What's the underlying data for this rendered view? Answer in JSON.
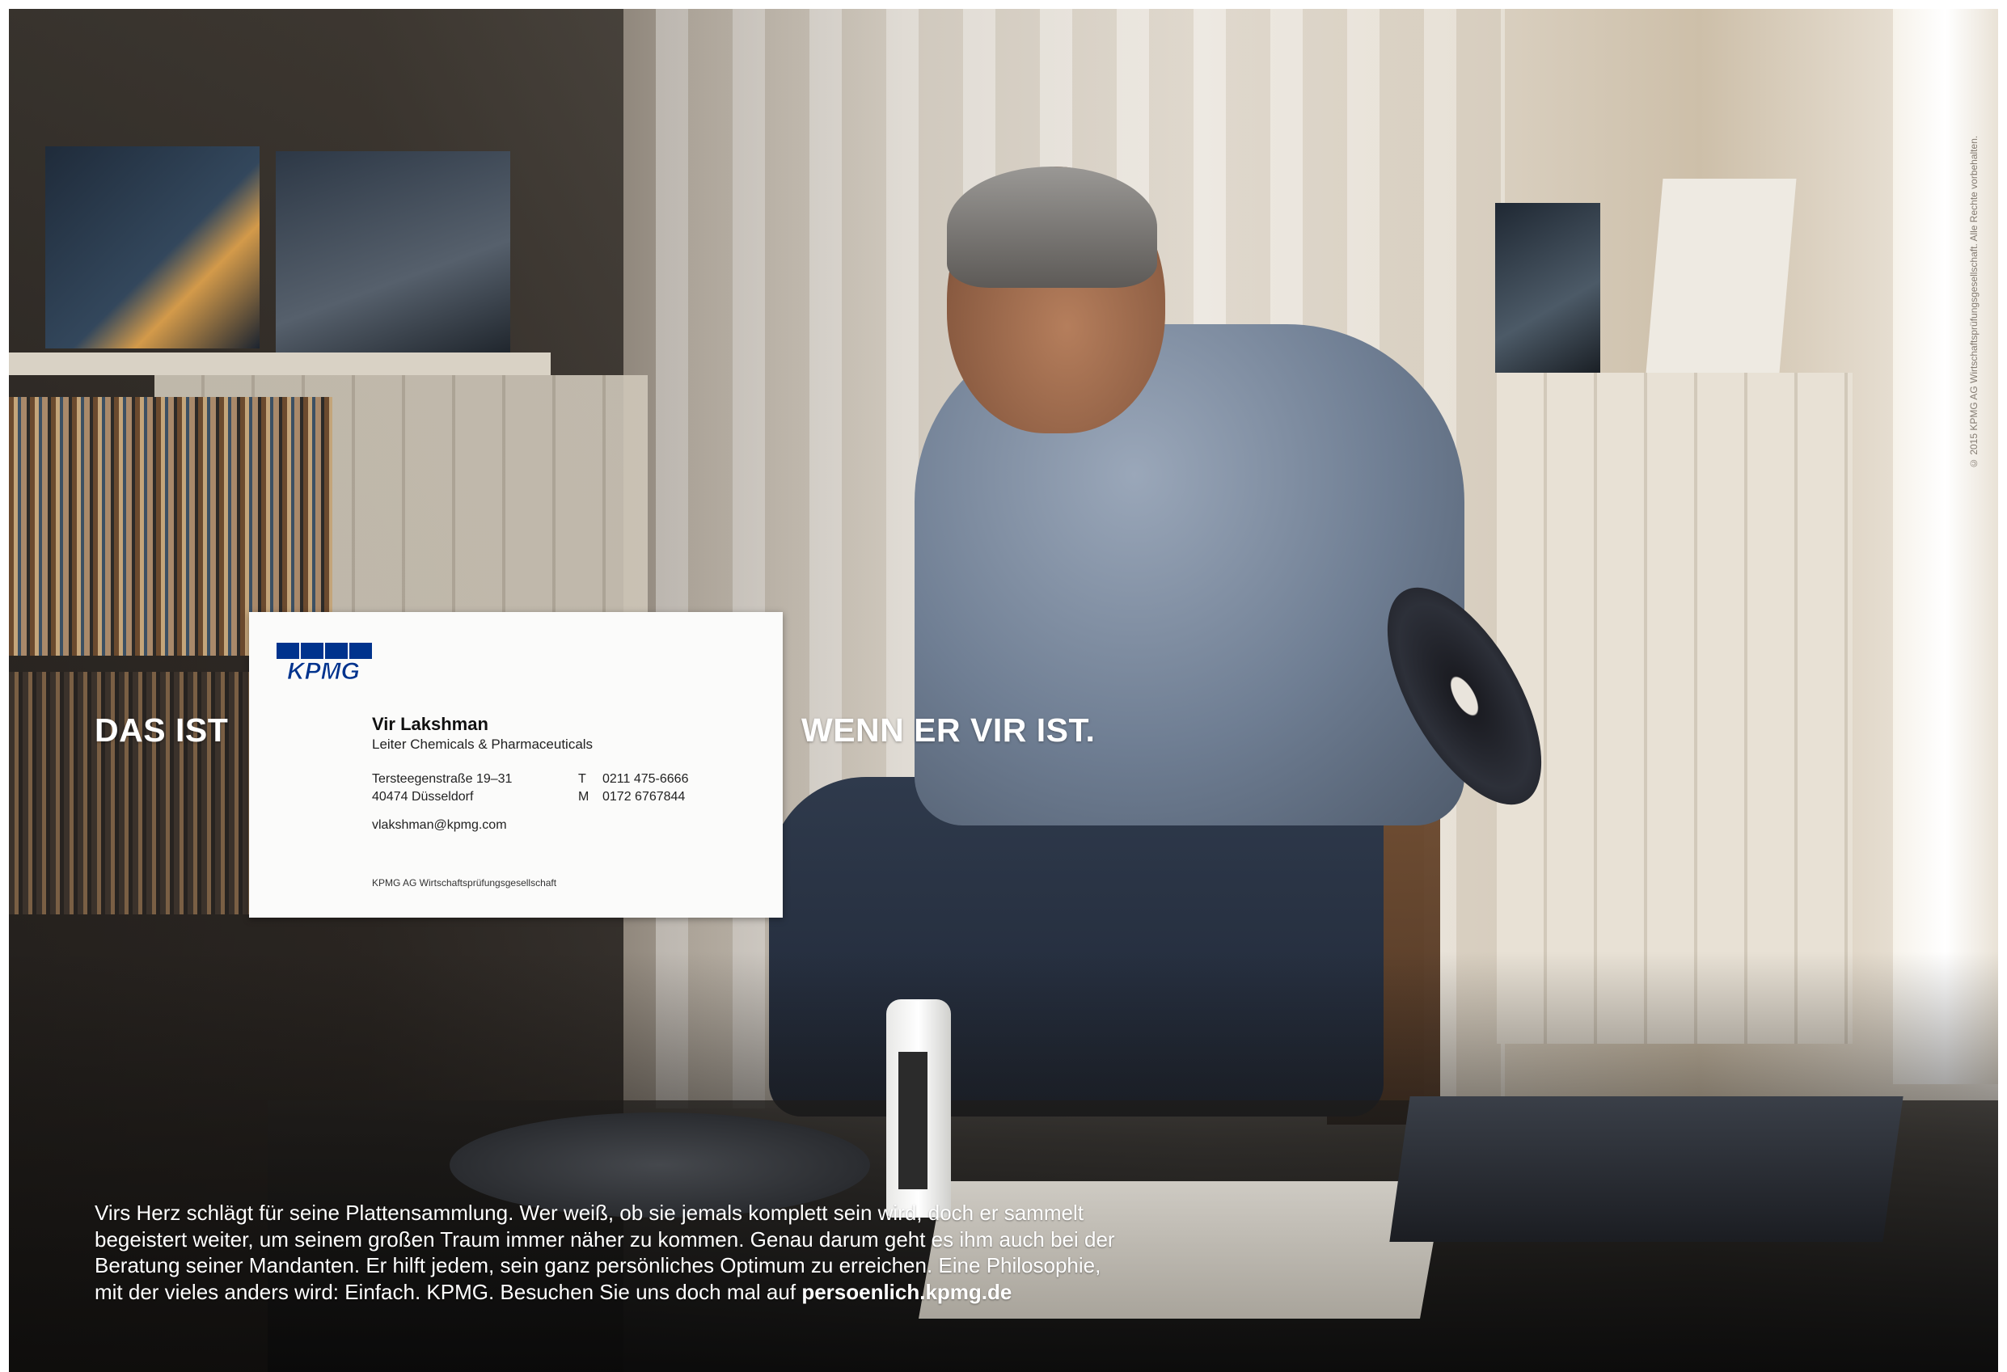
{
  "colors": {
    "kpmg_blue": "#00338d",
    "headline": "#ffffff",
    "card_background": "#fbfbfa"
  },
  "photo": {
    "scene": "man-cleaning-vinyl-record-in-living-room"
  },
  "card": {
    "logo_text": "KPMG",
    "name": "Vir Lakshman",
    "title": "Leiter Chemicals & Pharmaceuticals",
    "address_line1": "Tersteegenstraße 19–31",
    "address_line2": "40474 Düsseldorf",
    "phone_label": "T",
    "phone": "0211 475-6666",
    "mobile_label": "M",
    "mobile": "0172 6767844",
    "email": "vlakshman@kpmg.com",
    "company": "KPMG AG Wirtschaftsprüfungsgesellschaft"
  },
  "headline": {
    "left": "DAS IST",
    "right": "WENN ER VIR IST."
  },
  "body": {
    "line1": "Virs Herz schlägt für seine Plattensammlung. Wer weiß, ob sie jemals komplett sein wird, doch er sammelt",
    "line2": "begeistert weiter, um seinem großen Traum immer näher zu kommen. Genau darum geht es ihm auch bei der",
    "line3": "Beratung seiner Mandanten. Er hilft jedem, sein ganz persönliches Optimum zu erreichen. Eine Philosophie,",
    "line4_text": "mit der vieles anders wird: Einfach. KPMG. Besuchen Sie uns doch mal auf ",
    "url": "persoenlich.kpmg.de"
  },
  "copyright": "© 2015 KPMG AG Wirtschaftsprüfungsgesellschaft. Alle Rechte vorbehalten."
}
